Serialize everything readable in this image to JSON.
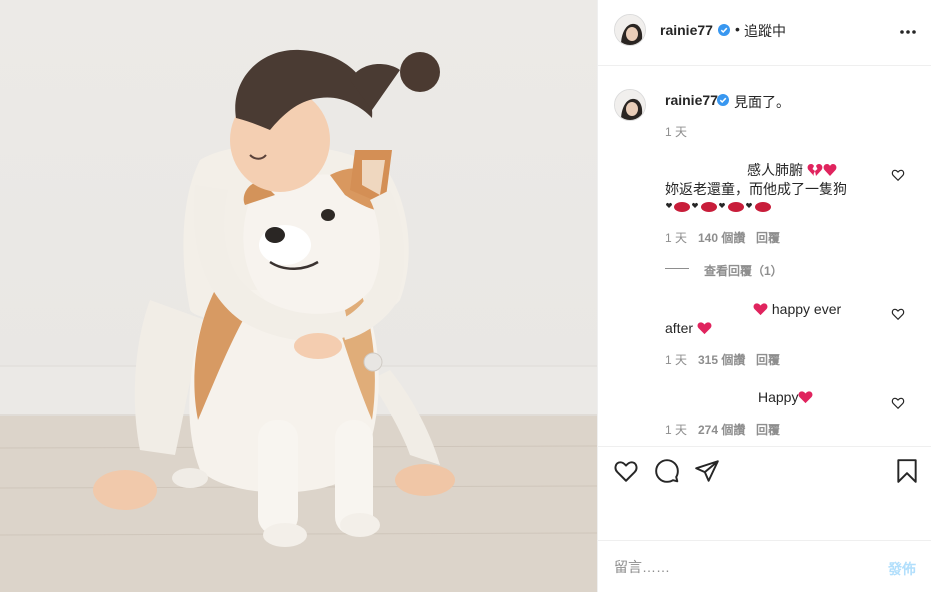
{
  "post": {
    "author": "rainie77",
    "follow_separator": "•",
    "follow_status": "追蹤中",
    "image_alt": "child hugging a shiba inu dog"
  },
  "caption": {
    "author": "rainie77",
    "text": "見面了。",
    "time": "1 天"
  },
  "comments": [
    {
      "line1": "感人肺腑",
      "line2": "妳返老還童，而他成了一隻狗",
      "time": "1 天",
      "likes": "140 個讚",
      "reply": "回覆",
      "view_replies": "查看回覆（1）"
    },
    {
      "line1": "happy ever",
      "line2": "after",
      "time": "1 天",
      "likes": "315 個讚",
      "reply": "回覆"
    },
    {
      "line1": "Happy",
      "time": "1 天",
      "likes": "274 個讚",
      "reply": "回覆"
    }
  ],
  "composer": {
    "placeholder": "留言……",
    "post_label": "發佈"
  },
  "icons": {
    "verified": "verified-badge-icon",
    "more": "more-options-icon",
    "like": "heart-icon",
    "comment": "comment-icon",
    "share": "paper-plane-icon",
    "save": "bookmark-icon"
  },
  "colors": {
    "verified_blue": "#3897f0",
    "heart_red": "#e0245e",
    "post_button_disabled": "#b2dffc",
    "muted_text": "#8e8e8e"
  }
}
